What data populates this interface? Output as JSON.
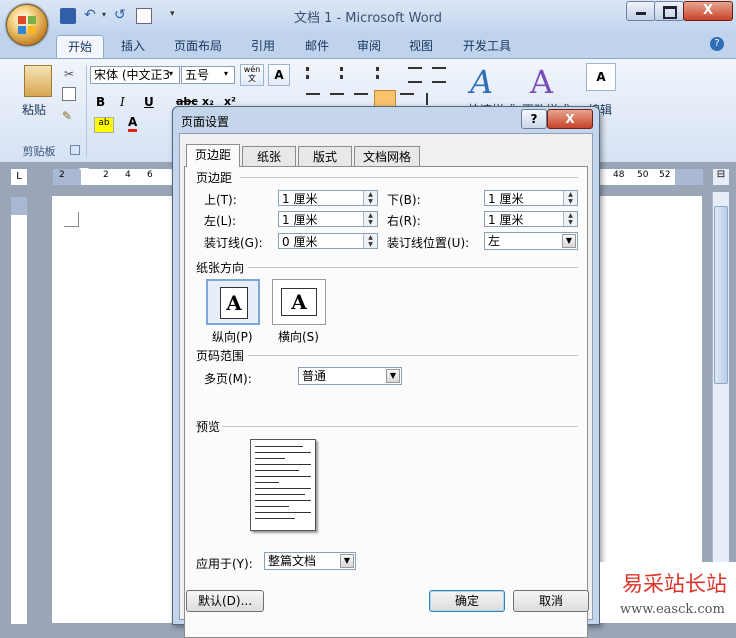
{
  "window": {
    "title": "文档 1 - Microsoft Word"
  },
  "ribbon": {
    "tabs": [
      {
        "label": "开始"
      },
      {
        "label": "插入"
      },
      {
        "label": "页面布局"
      },
      {
        "label": "引用"
      },
      {
        "label": "邮件"
      },
      {
        "label": "审阅"
      },
      {
        "label": "视图"
      },
      {
        "label": "开发工具"
      }
    ],
    "font_name": "宋体 (中文正3",
    "font_size": "五号",
    "paste_label": "粘贴",
    "clipboard_label": "剪贴板",
    "quick_styles_label": "快速样式",
    "change_styles_label": "更改样式",
    "edit_label": "编辑",
    "wen_label": "wén",
    "wen_char": "文"
  },
  "ruler": {
    "ticks": [
      "2",
      "2",
      "4",
      "6",
      "48",
      "50",
      "52"
    ]
  },
  "dialog": {
    "title": "页面设置",
    "help_label": "?",
    "close_label": "X",
    "tabs": [
      {
        "label": "页边距"
      },
      {
        "label": "纸张"
      },
      {
        "label": "版式"
      },
      {
        "label": "文档网格"
      }
    ],
    "margins": {
      "section_title": "页边距",
      "top_label": "上(T):",
      "top_value": "1 厘米",
      "bottom_label": "下(B):",
      "bottom_value": "1 厘米",
      "left_label": "左(L):",
      "left_value": "1 厘米",
      "right_label": "右(R):",
      "right_value": "1 厘米",
      "gutter_label": "装订线(G):",
      "gutter_value": "0 厘米",
      "gutter_pos_label": "装订线位置(U):",
      "gutter_pos_value": "左"
    },
    "orientation": {
      "section_title": "纸张方向",
      "portrait_label": "纵向(P)",
      "landscape_label": "横向(S)",
      "icon_letter": "A"
    },
    "pages": {
      "section_title": "页码范围",
      "multiple_label": "多页(M):",
      "multiple_value": "普通"
    },
    "preview": {
      "section_title": "预览"
    },
    "apply": {
      "label": "应用于(Y):",
      "value": "整篇文档"
    },
    "buttons": {
      "default": "默认(D)...",
      "ok": "确定",
      "cancel": "取消"
    }
  },
  "watermark": {
    "line1": "易采站长站",
    "line2": "www.easck.com"
  },
  "colors": {
    "highlight": "#ffff00",
    "accent": "#17365d"
  }
}
